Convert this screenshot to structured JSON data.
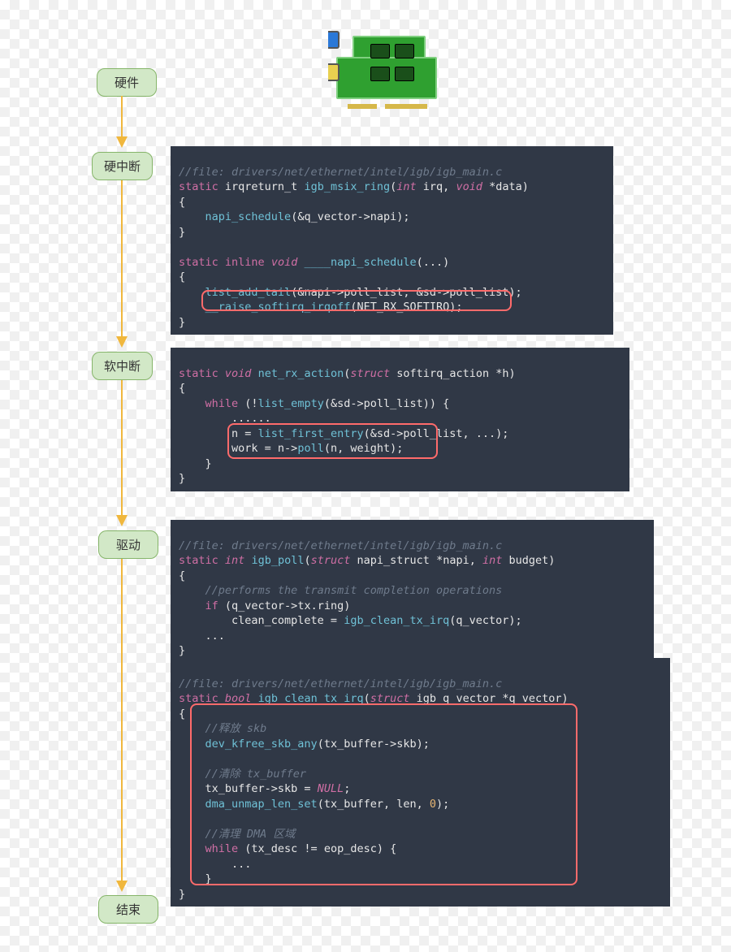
{
  "stages": {
    "hw": "硬件",
    "hardirq": "硬中断",
    "softirq": "软中断",
    "driver": "驱动",
    "end": "结束"
  },
  "code1": {
    "c01": "//file: drivers/net/ethernet/intel/igb/igb_main.c",
    "c02a": "static",
    "c02b": " irqreturn_t ",
    "c02c": "igb_msix_ring",
    "c02d": "(",
    "c02e": "int",
    "c02f": " irq, ",
    "c02g": "void",
    "c02h": " *data)",
    "c03": "{",
    "c04a": "    ",
    "c04b": "napi_schedule",
    "c04c": "(&q_vector->napi);",
    "c05": "}",
    "c06": "",
    "c07a": "static",
    "c07b": " ",
    "c07c": "inline",
    "c07d": " ",
    "c07e": "void",
    "c07f": " ",
    "c07g": "____napi_schedule",
    "c07h": "(...)",
    "c08": "{",
    "c09a": "    ",
    "c09b": "list_add_tail",
    "c09c": "(&napi->poll_list, &sd->poll_list);",
    "c10a": "    ",
    "c10b": "__raise_softirq_irqoff",
    "c10c": "(NET_RX_SOFTIRQ);",
    "c11": "}"
  },
  "code2": {
    "c01a": "static",
    "c01b": " ",
    "c01c": "void",
    "c01d": " ",
    "c01e": "net_rx_action",
    "c01f": "(",
    "c01g": "struct",
    "c01h": " softirq_action *h)",
    "c02": "{",
    "c03a": "    ",
    "c03b": "while",
    "c03c": " (!",
    "c03d": "list_empty",
    "c03e": "(&sd->poll_list)) {",
    "c04": "        ......",
    "c05a": "        n = ",
    "c05b": "list_first_entry",
    "c05c": "(&sd->poll_list, ...);",
    "c06a": "        work = n->",
    "c06b": "poll",
    "c06c": "(n, weight);",
    "c07": "    }",
    "c08": "}"
  },
  "code3": {
    "c01": "//file: drivers/net/ethernet/intel/igb/igb_main.c",
    "c02a": "static",
    "c02b": " ",
    "c02c": "int",
    "c02d": " ",
    "c02e": "igb_poll",
    "c02f": "(",
    "c02g": "struct",
    "c02h": " napi_struct *napi, ",
    "c02i": "int",
    "c02j": " budget)",
    "c03": "{",
    "c04a": "    ",
    "c04b": "//performs the transmit completion operations",
    "c05a": "    ",
    "c05b": "if",
    "c05c": " (q_vector->tx.ring)",
    "c06a": "        clean_complete = ",
    "c06b": "igb_clean_tx_irq",
    "c06c": "(q_vector);",
    "c07": "    ...",
    "c08": "}"
  },
  "code4": {
    "c01": "//file: drivers/net/ethernet/intel/igb/igb_main.c",
    "c02a": "static",
    "c02b": " ",
    "c02c": "bool",
    "c02d": " ",
    "c02e": "igb_clean_tx_irq",
    "c02f": "(",
    "c02g": "struct",
    "c02h": " igb_q_vector *q_vector)",
    "c03": "{",
    "c04a": "    ",
    "c04b": "//释放 skb",
    "c05a": "    ",
    "c05b": "dev_kfree_skb_any",
    "c05c": "(tx_buffer->skb);",
    "c06": "",
    "c07a": "    ",
    "c07b": "//清除 tx_buffer",
    "c08a": "    tx_buffer->skb = ",
    "c08b": "NULL",
    "c08c": ";",
    "c09a": "    ",
    "c09b": "dma_unmap_len_set",
    "c09c": "(tx_buffer, len, ",
    "c09d": "0",
    "c09e": ");",
    "c10": "",
    "c11a": "    ",
    "c11b": "//清理 DMA 区域",
    "c12a": "    ",
    "c12b": "while",
    "c12c": " (tx_desc != eop_desc) {",
    "c13": "        ...",
    "c14": "    }",
    "c15": "}"
  }
}
